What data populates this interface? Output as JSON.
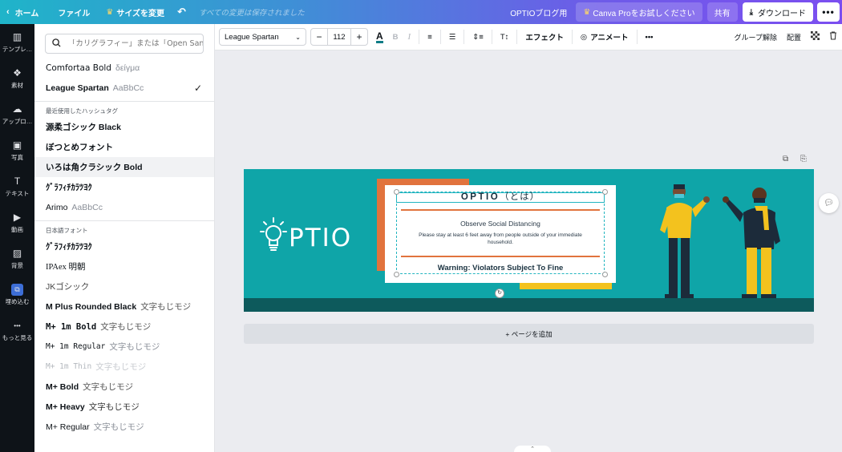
{
  "topbar": {
    "home": "ホーム",
    "file": "ファイル",
    "resize": "サイズを変更",
    "saved": "すべての変更は保存されました",
    "doc_title": "OPTIOブログ用",
    "canva_pro": "Canva Proをお試しください",
    "share": "共有",
    "download": "ダウンロード"
  },
  "rail": [
    {
      "icon": "template-icon",
      "glyph": "▥",
      "label": "テンプレ…"
    },
    {
      "icon": "elements-icon",
      "glyph": "❖",
      "label": "素材"
    },
    {
      "icon": "upload-icon",
      "glyph": "☁",
      "label": "アップロ…"
    },
    {
      "icon": "photo-icon",
      "glyph": "▣",
      "label": "写真"
    },
    {
      "icon": "text-icon",
      "glyph": "T",
      "label": "テキスト"
    },
    {
      "icon": "video-icon",
      "glyph": "▶",
      "label": "動画"
    },
    {
      "icon": "background-icon",
      "glyph": "▨",
      "label": "背景"
    },
    {
      "icon": "embed-icon",
      "glyph": "⧉",
      "label": "埋め込む"
    },
    {
      "icon": "more-icon",
      "glyph": "•••",
      "label": "もっと見る"
    }
  ],
  "panel": {
    "search_placeholder": "「カリグラフィー」または「Open Sans」",
    "top_fonts": [
      {
        "name": "Comfortaa Bold",
        "sample": "δείγμα"
      },
      {
        "name": "League Spartan",
        "sample": "AaBbCc"
      }
    ],
    "recent_heading": "最近使用したハッシュタグ",
    "recent_fonts": [
      {
        "name": "源柔ゴシック Black",
        "sample": ""
      },
      {
        "name": "ぼつとめフォント",
        "sample": ""
      },
      {
        "name": "いろは角クラシック Bold",
        "sample": ""
      },
      {
        "name": "ｸﾞﾗﾌｨﾁｶﾗﾂﾖｸ",
        "sample": ""
      },
      {
        "name": "Arimo",
        "sample": "AaBbCc"
      }
    ],
    "japanese_heading": "日本語フォント",
    "japanese_fonts": [
      {
        "name": "ｸﾞﾗﾌｨﾁｶﾗﾂﾖｸ",
        "sample": ""
      },
      {
        "name": "IPAex 明朝",
        "sample": ""
      },
      {
        "name": "JKゴシック",
        "sample": ""
      },
      {
        "name": "M Plus Rounded Black",
        "sample": "文字もじモジ"
      },
      {
        "name": "M+ 1m Bold",
        "sample": "文字もじモジ"
      },
      {
        "name": "M+ 1m Regular",
        "sample": "文字もじモジ"
      },
      {
        "name": "M+ 1m Thin",
        "sample": "文字もじモジ"
      },
      {
        "name": "M+ Bold",
        "sample": "文字もじモジ"
      },
      {
        "name": "M+ Heavy",
        "sample": "文字もじモジ"
      },
      {
        "name": "M+ Regular",
        "sample": "文字もじモジ"
      }
    ]
  },
  "toolbar": {
    "font": "League Spartan",
    "size": "112",
    "effects": "エフェクト",
    "animate": "アニメート",
    "ungroup": "グループ解除",
    "position": "配置"
  },
  "banner": {
    "logo": "PTIO",
    "title": "OPTIO",
    "title_suffix": "（とは）",
    "subtitle": "Observe Social Distancing",
    "body": "Please stay at least 6 feet away from people outside of your immediate household.",
    "warning": "Warning: Violators Subject To Fine"
  },
  "canvas": {
    "add_page": "+ ページを追加"
  },
  "colors": {
    "banner_bg": "#0fa5a8",
    "orange": "#e1733d",
    "yellow": "#f3c21e",
    "dark_teal": "#0d5a5c",
    "selection": "#23b5c0"
  }
}
